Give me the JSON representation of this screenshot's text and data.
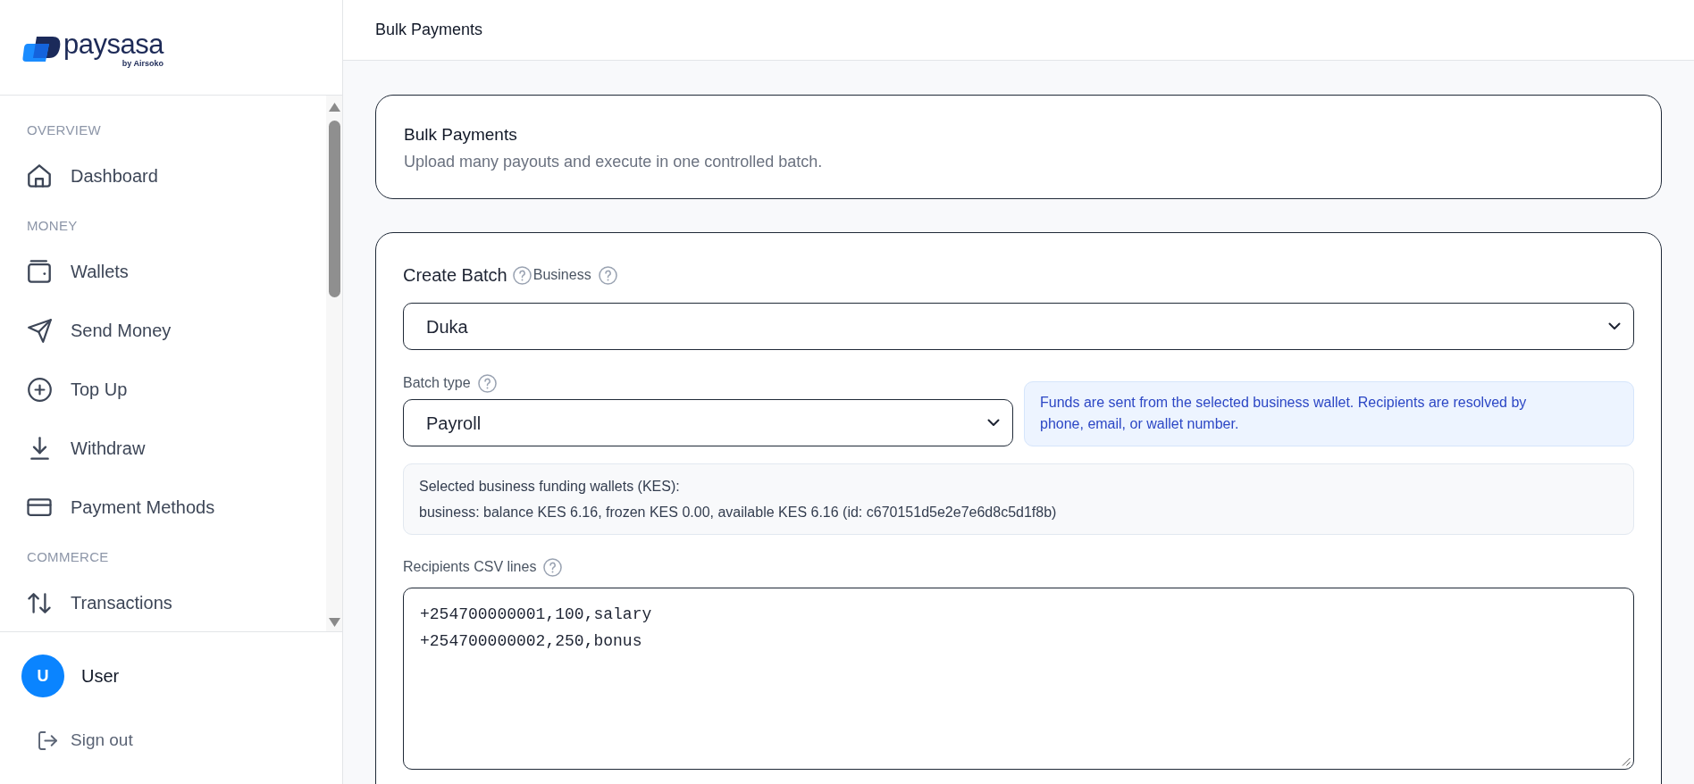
{
  "sidebar": {
    "logo": {
      "wordmark": "paysasa",
      "tagline": "by Airsoko"
    },
    "sections": [
      {
        "heading": "OVERVIEW",
        "items": [
          {
            "label": "Dashboard",
            "selected": false
          }
        ]
      },
      {
        "heading": "MONEY",
        "items": [
          {
            "label": "Wallets",
            "selected": false
          },
          {
            "label": "Send Money",
            "selected": false
          },
          {
            "label": "Top Up",
            "selected": false
          },
          {
            "label": "Withdraw",
            "selected": false
          },
          {
            "label": "Payment Methods",
            "selected": false
          }
        ]
      },
      {
        "heading": "COMMERCE",
        "items": [
          {
            "label": "Transactions",
            "selected": false
          }
        ]
      }
    ],
    "user": {
      "initial": "U",
      "name": "User"
    },
    "sign_out": "Sign out"
  },
  "header": {
    "title": "Bulk Payments"
  },
  "intro_card": {
    "title": "Bulk Payments",
    "subtitle": "Upload many payouts and execute in one controlled batch."
  },
  "batch_form": {
    "title": "Create Batch",
    "business": {
      "label": "Business",
      "value": "Duka"
    },
    "batch_type": {
      "label": "Batch type",
      "value": "Payroll"
    },
    "notice": "Funds are sent from the selected business wallet. Recipients are resolved by phone, email, or wallet number.",
    "wallets": {
      "heading": "Selected business funding wallets (KES):",
      "lines": [
        "business: balance KES 6.16, frozen KES 0.00, available KES 6.16 (id: c670151d5e2e7e6d8c5d1f8b)"
      ]
    },
    "recipients": {
      "label": "Recipients CSV lines",
      "value": "+254700000001,100,salary\n+254700000002,250,bonus"
    }
  }
}
